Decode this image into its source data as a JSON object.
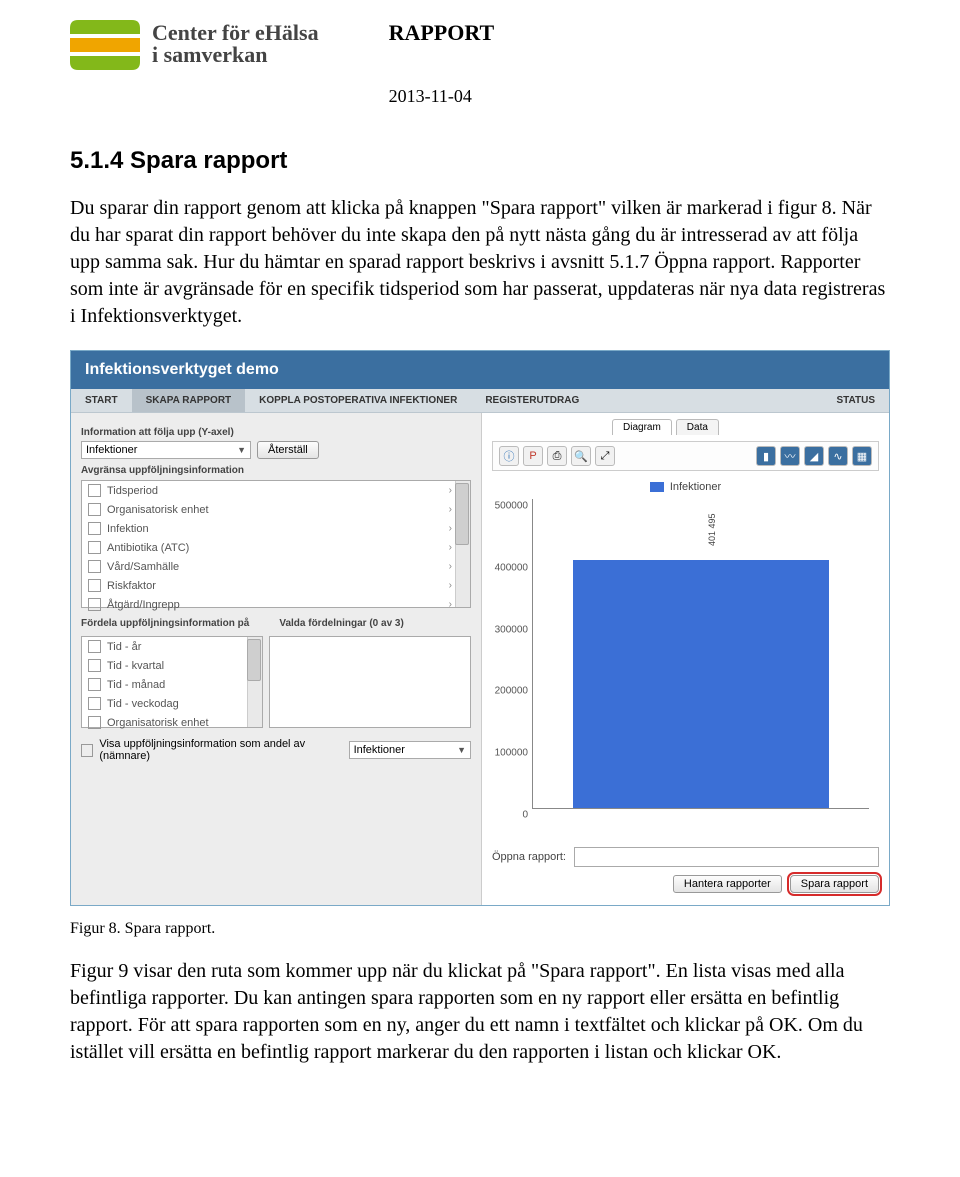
{
  "doc": {
    "logo_line1": "Center för eHälsa",
    "logo_line2": "i samverkan",
    "type": "RAPPORT",
    "date": "2013-11-04"
  },
  "section": {
    "number_title": "5.1.4  Spara rapport",
    "para1": "Du sparar din rapport genom att klicka på knappen \"Spara rapport\" vilken är markerad i figur 8. När du har sparat din rapport behöver du inte skapa den på nytt nästa gång du är intresserad av att följa upp samma sak. Hur du hämtar en sparad rapport beskrivs i avsnitt 5.1.7 Öppna rapport. Rapporter som inte är avgränsade för en specifik tidsperiod som har passerat, uppdateras när nya data registreras i Infektionsverktyget.",
    "caption": "Figur 8. Spara rapport.",
    "para2": "Figur 9 visar den ruta som kommer upp när du klickat på \"Spara rapport\". En lista visas med alla befintliga rapporter. Du kan antingen spara rapporten som en ny rapport eller ersätta en befintlig rapport. För att spara rapporten som en ny, anger du ett namn i textfältet och klickar på OK. Om du istället vill ersätta en befintlig rapport markerar du den rapporten i listan och klickar OK."
  },
  "app": {
    "title": "Infektionsverktyget demo",
    "nav": [
      "START",
      "SKAPA RAPPORT",
      "KOPPLA POSTOPERATIVA INFEKTIONER",
      "REGISTERUTDRAG"
    ],
    "nav_right": "STATUS",
    "yaxis_label": "Information att följa upp (Y-axel)",
    "yaxis_value": "Infektioner",
    "reset_btn": "Återställ",
    "filter_label": "Avgränsa uppföljningsinformation",
    "filters": [
      "Tidsperiod",
      "Organisatorisk enhet",
      "Infektion",
      "Antibiotika (ATC)",
      "Vård/Samhälle",
      "Riskfaktor",
      "Åtgärd/Ingrepp"
    ],
    "dist_label": "Fördela uppföljningsinformation på",
    "dist_label2": "Valda fördelningar (0 av 3)",
    "dist_items": [
      "Tid - år",
      "Tid - kvartal",
      "Tid - månad",
      "Tid - veckodag",
      "Organisatorisk enhet"
    ],
    "share_label": "Visa uppföljningsinformation som andel av (nämnare)",
    "share_value": "Infektioner",
    "tabs": [
      "Diagram",
      "Data"
    ],
    "toolbar_left_icons": [
      "info-icon",
      "export-ppt-icon",
      "print-icon",
      "zoom-icon",
      "expand-icon"
    ],
    "toolbar_right_icons": [
      "chart-bar-icon",
      "chart-line-icon",
      "chart-area-icon",
      "chart-wave-icon",
      "chart-grid-icon"
    ],
    "legend": "Infektioner",
    "open_label": "Öppna rapport:",
    "manage_btn": "Hantera rapporter",
    "save_btn": "Spara rapport"
  },
  "chart_data": {
    "type": "bar",
    "categories": [
      ""
    ],
    "values": [
      401495
    ],
    "value_label": "401 495",
    "series_name": "Infektioner",
    "ylim": [
      0,
      500000
    ],
    "yticks": [
      0,
      100000,
      200000,
      300000,
      400000,
      500000
    ],
    "title": "",
    "xlabel": "",
    "ylabel": ""
  },
  "icons": {
    "info": "ⓘ",
    "ppt": "P",
    "print": "⎙",
    "zoom": "🔍",
    "expand": "⤢",
    "bar": "▮",
    "line": "〰",
    "area": "◢",
    "wave": "∿",
    "grid": "▦"
  }
}
